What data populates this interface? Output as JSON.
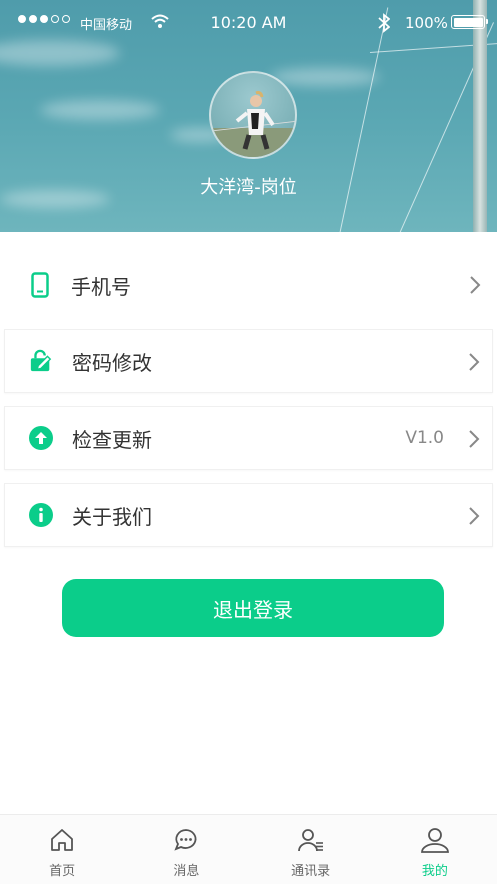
{
  "status_bar": {
    "carrier": "中国移动",
    "time": "10:20 AM",
    "battery": "100%"
  },
  "profile": {
    "name": "大洋湾-岗位"
  },
  "menu": [
    {
      "label": "手机号",
      "icon": "phone-icon",
      "value": ""
    },
    {
      "label": "密码修改",
      "icon": "lock-edit-icon",
      "value": ""
    },
    {
      "label": "检查更新",
      "icon": "upload-arrow-icon",
      "value": "V1.0"
    },
    {
      "label": "关于我们",
      "icon": "info-icon",
      "value": ""
    }
  ],
  "logout_label": "退出登录",
  "tabs": [
    {
      "label": "首页",
      "icon": "home-icon",
      "active": false
    },
    {
      "label": "消息",
      "icon": "chat-bubble-icon",
      "active": false
    },
    {
      "label": "通讯录",
      "icon": "contacts-icon",
      "active": false
    },
    {
      "label": "我的",
      "icon": "profile-icon",
      "active": true
    }
  ],
  "colors": {
    "accent": "#0bcd8a",
    "text": "#333333",
    "muted": "#888888",
    "header_sky": "#5aa7b3"
  }
}
